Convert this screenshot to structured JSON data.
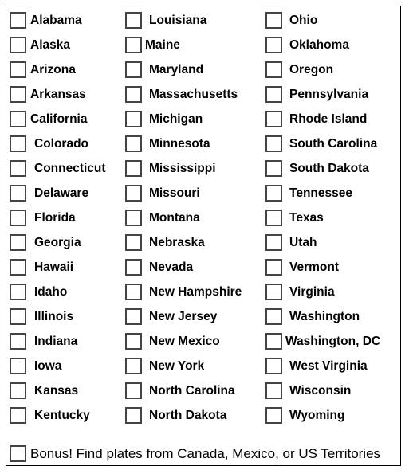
{
  "columns": [
    [
      "Alabama",
      "Alaska",
      "Arizona",
      "Arkansas",
      "California",
      "Colorado",
      "Connecticut",
      "Delaware",
      "Florida",
      "Georgia",
      "Hawaii",
      "Idaho",
      "Illinois",
      "Indiana",
      "Iowa",
      "Kansas",
      "Kentucky"
    ],
    [
      "Louisiana",
      "Maine",
      "Maryland",
      "Massachusetts",
      "Michigan",
      "Minnesota",
      "Mississippi",
      "Missouri",
      "Montana",
      "Nebraska",
      "Nevada",
      "New Hampshire",
      "New Jersey",
      "New Mexico",
      "New York",
      "North Carolina",
      "North Dakota"
    ],
    [
      "Ohio",
      "Oklahoma",
      "Oregon",
      "Pennsylvania",
      "Rhode Island",
      "South Carolina",
      "South Dakota",
      "Tennessee",
      "Texas",
      "Utah",
      "Vermont",
      "Virginia",
      "Washington",
      "Washington, DC",
      "West Virginia",
      "Wisconsin",
      "Wyoming"
    ]
  ],
  "bonus": {
    "label": "Bonus! Find plates from Canada, Mexico, or US Territories"
  },
  "checked": false
}
